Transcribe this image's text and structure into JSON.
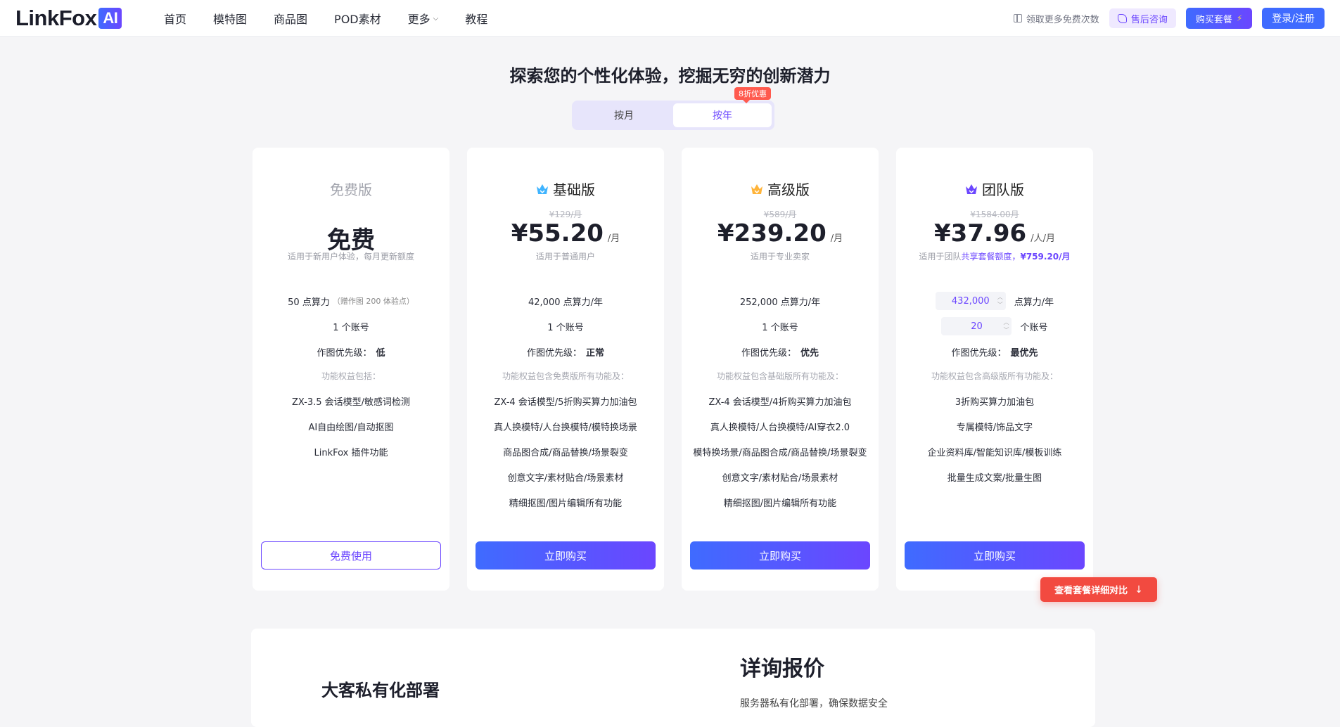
{
  "header": {
    "logo_text": "LinkFox",
    "logo_badge": "AI",
    "nav": [
      "首页",
      "模特图",
      "商品图",
      "POD素材",
      "更多",
      "教程"
    ],
    "free_link": "领取更多免费次数",
    "support": "售后咨询",
    "buy": "购买套餐",
    "login": "登录/注册"
  },
  "hero": {
    "title": "探索您的个性化体验，挖掘无穷的创新潜力",
    "toggle": [
      "按月",
      "按年"
    ],
    "active_toggle": "按年",
    "discount": "8折优惠"
  },
  "plans": [
    {
      "name": "免费版",
      "orig_price": "",
      "price": "免费",
      "unit": "",
      "desc": "适用于新用户体验，每月更新额度",
      "points": "50 点算力",
      "points_sub": "（赠作图 200 体验点）",
      "accounts": "1 个账号",
      "priority_label": "作图优先级：",
      "priority": "低",
      "feat_title": "功能权益包括：",
      "features": [
        "ZX-3.5 会话模型/敏感词检测",
        "AI自由绘图/自动抠图",
        "LinkFox 插件功能"
      ],
      "button": "免费使用"
    },
    {
      "name": "基础版",
      "crown_color": "#3fb4ff",
      "orig_price": "¥129/月",
      "price": "¥55.20",
      "unit": "/月",
      "desc": "适用于普通用户",
      "points": "42,000 点算力/年",
      "accounts": "1 个账号",
      "priority_label": "作图优先级：",
      "priority": "正常",
      "feat_title": "功能权益包含免费版所有功能及：",
      "features": [
        "ZX-4 会话模型/5折购买算力加油包",
        "真人换模特/人台换模特/模特换场景",
        "商品图合成/商品替换/场景裂变",
        "创意文字/素材贴合/场景素材",
        "精细抠图/图片编辑所有功能"
      ],
      "button": "立即购买"
    },
    {
      "name": "高级版",
      "crown_color": "#ffb43a",
      "orig_price": "¥589/月",
      "price": "¥239.20",
      "unit": "/月",
      "desc": "适用于专业卖家",
      "points": "252,000 点算力/年",
      "accounts": "1 个账号",
      "priority_label": "作图优先级：",
      "priority": "优先",
      "feat_title": "功能权益包含基础版所有功能及：",
      "features": [
        "ZX-4 会话模型/4折购买算力加油包",
        "真人换模特/人台换模特/AI穿衣2.0",
        "模特换场景/商品图合成/商品替换/场景裂变",
        "创意文字/素材贴合/场景素材",
        "精细抠图/图片编辑所有功能"
      ],
      "button": "立即购买"
    },
    {
      "name": "团队版",
      "crown_color": "#6b46ff",
      "orig_price": "¥1584.00月",
      "price": "¥37.96",
      "unit": "/人/月",
      "desc_pre": "适用于团队",
      "desc_hl": "共享套餐额度，",
      "desc_hl_b": "¥759.20/月",
      "points_value": "432,000",
      "points_label": "点算力/年",
      "accounts_value": "20",
      "accounts_label": "个账号",
      "priority_label": "作图优先级：",
      "priority": "最优先",
      "feat_title": "功能权益包含高级版所有功能及：",
      "features": [
        "3折购买算力加油包",
        "专属模特/饰品文字",
        "企业资料库/智能知识库/模板训练",
        "批量生成文案/批量生图"
      ],
      "button": "立即购买"
    }
  ],
  "compare": "查看套餐详细对比",
  "bottom": {
    "left_title": "大客私有化部署",
    "right_title": "详询报价",
    "right_sub": "服务器私有化部署，确保数据安全"
  }
}
